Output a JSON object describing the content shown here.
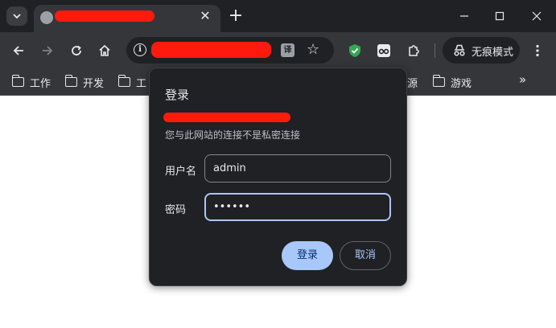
{
  "tab": {
    "close_glyph": "✕"
  },
  "new_tab": "+",
  "window": {
    "minimize": "—",
    "maximize": "☐",
    "close": "✕"
  },
  "incognito": {
    "label": "无痕模式"
  },
  "bookmarks": [
    {
      "label": "工作"
    },
    {
      "label": "开发"
    },
    {
      "label": "工"
    },
    {
      "label": "源"
    },
    {
      "label": "游戏"
    }
  ],
  "bookmarks_more": "»",
  "dialog": {
    "title": "登录",
    "subtitle": "您与此网站的连接不是私密连接",
    "username_label": "用户名",
    "username_value": "admin",
    "password_label": "密码",
    "password_value": "••••••",
    "login_button": "登录",
    "cancel_button": "取消"
  },
  "colors": {
    "frame": "#202124",
    "toolbar": "#35363a",
    "accent": "#a8c7fa",
    "redaction": "#ff1a0d"
  }
}
